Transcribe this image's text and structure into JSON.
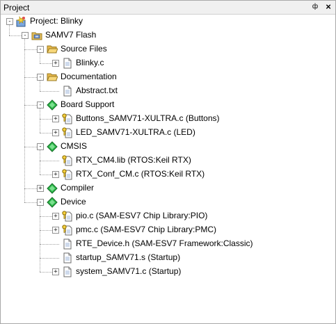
{
  "panel": {
    "title": "Project",
    "pin_glyph": "ф",
    "close_glyph": "×"
  },
  "tree": {
    "project": {
      "label": "Project: Blinky",
      "icon": "project-icon",
      "expander": "-"
    },
    "target": {
      "label": "SAMV7 Flash",
      "icon": "target-folder-icon",
      "expander": "-"
    },
    "groups": [
      {
        "label": "Source Files",
        "icon": "folder-open-icon",
        "expander": "-",
        "items": [
          {
            "label": "Blinky.c",
            "icon": "file-icon",
            "expander": "+"
          }
        ]
      },
      {
        "label": "Documentation",
        "icon": "folder-open-icon",
        "expander": "-",
        "items": [
          {
            "label": "Abstract.txt",
            "icon": "file-icon",
            "expander": ""
          }
        ]
      },
      {
        "label": "Board Support",
        "icon": "component-diamond-icon",
        "expander": "-",
        "items": [
          {
            "label": "Buttons_SAMV71-XULTRA.c (Buttons)",
            "icon": "key-file-icon",
            "expander": "+"
          },
          {
            "label": "LED_SAMV71-XULTRA.c (LED)",
            "icon": "key-file-icon",
            "expander": "+"
          }
        ]
      },
      {
        "label": "CMSIS",
        "icon": "component-diamond-icon",
        "expander": "-",
        "items": [
          {
            "label": "RTX_CM4.lib (RTOS:Keil RTX)",
            "icon": "key-file-icon",
            "expander": ""
          },
          {
            "label": "RTX_Conf_CM.c (RTOS:Keil RTX)",
            "icon": "key-file-icon",
            "expander": "+"
          }
        ]
      },
      {
        "label": "Compiler",
        "icon": "component-diamond-icon",
        "expander": "+",
        "items": []
      },
      {
        "label": "Device",
        "icon": "component-diamond-icon",
        "expander": "-",
        "items": [
          {
            "label": "pio.c (SAM-ESV7 Chip Library:PIO)",
            "icon": "key-file-icon",
            "expander": "+"
          },
          {
            "label": "pmc.c (SAM-ESV7 Chip Library:PMC)",
            "icon": "key-file-icon",
            "expander": "+"
          },
          {
            "label": "RTE_Device.h (SAM-ESV7 Framework:Classic)",
            "icon": "file-icon",
            "expander": ""
          },
          {
            "label": "startup_SAMV71.s (Startup)",
            "icon": "file-icon",
            "expander": ""
          },
          {
            "label": "system_SAMV71.c (Startup)",
            "icon": "file-icon",
            "expander": "+"
          }
        ]
      }
    ]
  }
}
